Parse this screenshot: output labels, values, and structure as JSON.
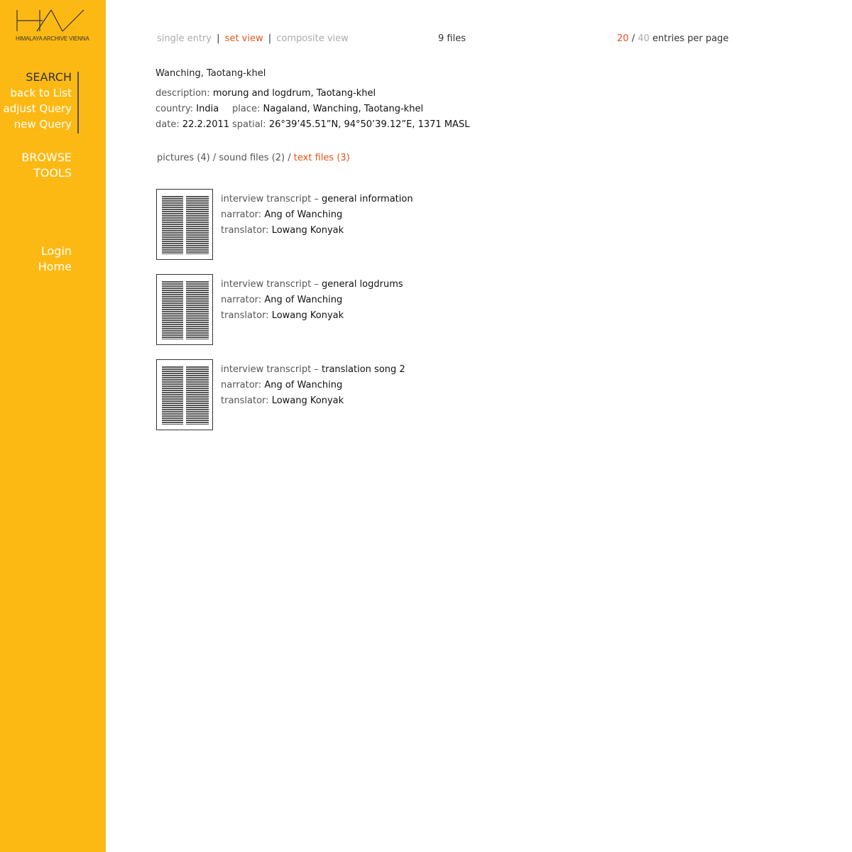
{
  "logo": {
    "mark": "HAV",
    "subtitle": "HIMALAYA ARCHIVE VIENNA"
  },
  "sidebar": {
    "search": {
      "heading": "SEARCH",
      "items": [
        "back to List",
        "adjust Query",
        "new Query"
      ]
    },
    "browse": [
      "BROWSE",
      "TOOLS"
    ],
    "account": [
      "Login",
      "Home"
    ]
  },
  "topbar": {
    "single_entry": "single entry",
    "set_view": "set view",
    "composite_view": "composite view",
    "separator": "|",
    "file_count": "9 files",
    "per_page_20": "20",
    "per_page_sep": "/",
    "per_page_40": "40",
    "per_page_label": "entries per page"
  },
  "entry": {
    "title": "Wanching, Taotang-khel",
    "description_label": "description:",
    "description": "morung and logdrum, Taotang-khel",
    "country_label": "country:",
    "country": "India",
    "place_label": "place:",
    "place": "Nagaland, Wanching, Taotang-khel",
    "date_label": "date:",
    "date": "22.2.2011",
    "spatial_label": "spatial:",
    "spatial": "26°39’45.51”N, 94°50’39.12”E, 1371 MASL"
  },
  "file_tabs": {
    "pictures": "pictures (4)",
    "sound": "sound files (2)",
    "text": "text files (3)",
    "sep": "/"
  },
  "files": [
    {
      "type_label": "interview transcript –",
      "title": "general information",
      "narrator_label": "narrator:",
      "narrator": "Ang of Wanching",
      "translator_label": "translator:",
      "translator": "Lowang Konyak"
    },
    {
      "type_label": "interview transcript –",
      "title": "general logdrums",
      "narrator_label": "narrator:",
      "narrator": "Ang of Wanching",
      "translator_label": "translator:",
      "translator": "Lowang Konyak"
    },
    {
      "type_label": "interview transcript –",
      "title": "translation song 2",
      "narrator_label": "narrator:",
      "narrator": "Ang of Wanching",
      "translator_label": "translator:",
      "translator": "Lowang Konyak"
    }
  ],
  "colors": {
    "sidebar": "#FDB913",
    "accent": "#E8541E",
    "inactive": "#aaaaaa"
  }
}
